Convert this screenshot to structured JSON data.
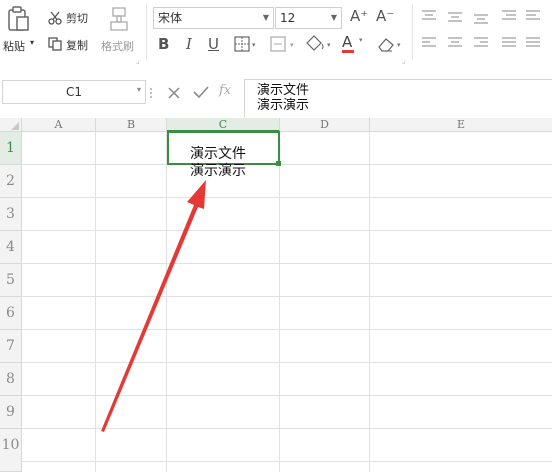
{
  "ribbon": {
    "paste_label": "粘贴",
    "cut_label": "剪切",
    "copy_label": "复制",
    "format_painter_label": "格式刷",
    "font_name": "宋体",
    "font_size": "12",
    "grow_font": "A⁺",
    "shrink_font": "A⁻",
    "bold": "B",
    "italic": "I",
    "underline": "U",
    "font_color_letter": "A"
  },
  "formula_bar": {
    "name_box": "C1",
    "fx": "fx",
    "content_line1": "演示文件",
    "content_line2": "演示演示"
  },
  "grid": {
    "columns": [
      "A",
      "B",
      "C",
      "D",
      "E"
    ],
    "rows": [
      "1",
      "2",
      "3",
      "4",
      "5",
      "6",
      "7",
      "8",
      "9",
      "10"
    ],
    "selected_cell": "C1",
    "cell_c1_line1": "演示文件",
    "cell_c1_line2": "演示演示"
  },
  "colors": {
    "selection": "#3b8e41",
    "arrow": "#e53935",
    "font_color_bar": "#e53935"
  }
}
